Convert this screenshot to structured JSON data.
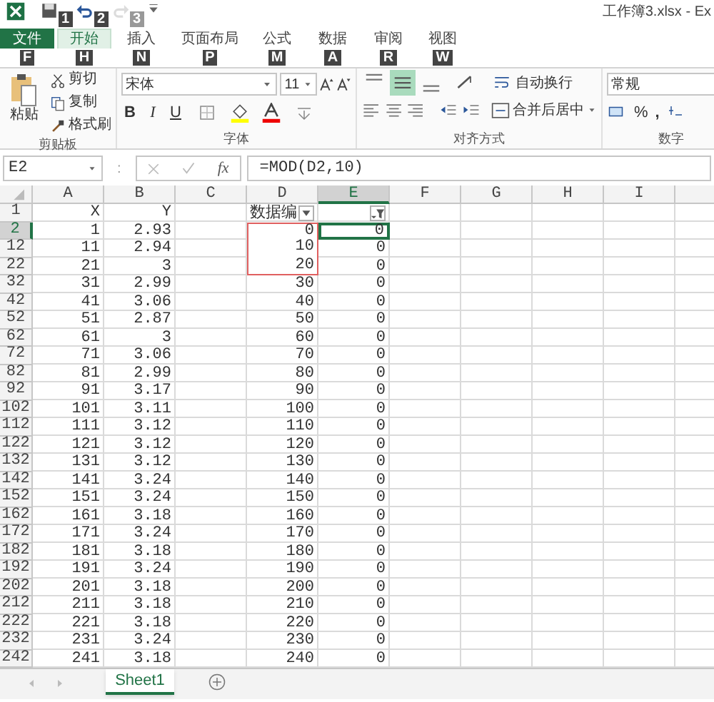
{
  "window": {
    "title": "工作簿3.xlsx - Ex"
  },
  "quick_access": [
    {
      "kind": "save",
      "keytip": "1",
      "disabled": false
    },
    {
      "kind": "undo",
      "keytip": "2",
      "disabled": false
    },
    {
      "kind": "redo",
      "keytip": "3",
      "disabled": true
    }
  ],
  "tabs": [
    {
      "label": "文件",
      "keytip": "F",
      "kind": "file",
      "selected": false
    },
    {
      "label": "开始",
      "keytip": "H",
      "kind": "tab",
      "selected": true
    },
    {
      "label": "插入",
      "keytip": "N",
      "kind": "tab",
      "selected": false
    },
    {
      "label": "页面布局",
      "keytip": "P",
      "kind": "tab",
      "selected": false
    },
    {
      "label": "公式",
      "keytip": "M",
      "kind": "tab",
      "selected": false
    },
    {
      "label": "数据",
      "keytip": "A",
      "kind": "tab",
      "selected": false
    },
    {
      "label": "审阅",
      "keytip": "R",
      "kind": "tab",
      "selected": false
    },
    {
      "label": "视图",
      "keytip": "W",
      "kind": "tab",
      "selected": false
    }
  ],
  "ribbon": {
    "clipboard": {
      "label": "剪贴板",
      "paste": "粘贴",
      "cut": "剪切",
      "copy": "复制",
      "format_painter": "格式刷"
    },
    "font": {
      "label": "字体",
      "font_name": "宋体",
      "font_size": "11",
      "bold": "B",
      "italic": "I",
      "underline": "U"
    },
    "alignment": {
      "label": "对齐方式",
      "vertical": [
        {
          "kind": "top",
          "selected": false
        },
        {
          "kind": "middle",
          "selected": true
        },
        {
          "kind": "bottom",
          "selected": false
        }
      ],
      "wrap_text": "自动换行",
      "merge_center": "合并后居中"
    },
    "number": {
      "label": "数字",
      "format": "常规",
      "percent": "%",
      "comma": ","
    }
  },
  "formula_bar": {
    "name_box": "E2",
    "separator": ":",
    "function_label": "fx",
    "formula": "=MOD(D2,10)"
  },
  "columns": [
    {
      "label": "A",
      "selected": false
    },
    {
      "label": "B",
      "selected": false
    },
    {
      "label": "C",
      "selected": false
    },
    {
      "label": "D",
      "selected": false
    },
    {
      "label": "E",
      "selected": true
    },
    {
      "label": "F",
      "selected": false
    },
    {
      "label": "G",
      "selected": false
    },
    {
      "label": "H",
      "selected": false
    },
    {
      "label": "I",
      "selected": false
    }
  ],
  "header_row": {
    "number": "1",
    "a": "X",
    "b": "Y",
    "d": "数据编",
    "d_filter": {
      "active": false
    },
    "e_filter": {
      "active": true
    }
  },
  "rows": [
    {
      "number": "2",
      "a": "1",
      "b": "2.93",
      "d": "0",
      "e": "0",
      "selected": true,
      "marked": true
    },
    {
      "number": "12",
      "a": "11",
      "b": "2.94",
      "d": "10",
      "e": "0",
      "selected": false,
      "marked": true
    },
    {
      "number": "22",
      "a": "21",
      "b": "3",
      "d": "20",
      "e": "0",
      "selected": false,
      "marked": true
    },
    {
      "number": "32",
      "a": "31",
      "b": "2.99",
      "d": "30",
      "e": "0",
      "selected": false,
      "marked": false
    },
    {
      "number": "42",
      "a": "41",
      "b": "3.06",
      "d": "40",
      "e": "0",
      "selected": false,
      "marked": false
    },
    {
      "number": "52",
      "a": "51",
      "b": "2.87",
      "d": "50",
      "e": "0",
      "selected": false,
      "marked": false
    },
    {
      "number": "62",
      "a": "61",
      "b": "3",
      "d": "60",
      "e": "0",
      "selected": false,
      "marked": false
    },
    {
      "number": "72",
      "a": "71",
      "b": "3.06",
      "d": "70",
      "e": "0",
      "selected": false,
      "marked": false
    },
    {
      "number": "82",
      "a": "81",
      "b": "2.99",
      "d": "80",
      "e": "0",
      "selected": false,
      "marked": false
    },
    {
      "number": "92",
      "a": "91",
      "b": "3.17",
      "d": "90",
      "e": "0",
      "selected": false,
      "marked": false
    },
    {
      "number": "102",
      "a": "101",
      "b": "3.11",
      "d": "100",
      "e": "0",
      "selected": false,
      "marked": false
    },
    {
      "number": "112",
      "a": "111",
      "b": "3.12",
      "d": "110",
      "e": "0",
      "selected": false,
      "marked": false
    },
    {
      "number": "122",
      "a": "121",
      "b": "3.12",
      "d": "120",
      "e": "0",
      "selected": false,
      "marked": false
    },
    {
      "number": "132",
      "a": "131",
      "b": "3.12",
      "d": "130",
      "e": "0",
      "selected": false,
      "marked": false
    },
    {
      "number": "142",
      "a": "141",
      "b": "3.24",
      "d": "140",
      "e": "0",
      "selected": false,
      "marked": false
    },
    {
      "number": "152",
      "a": "151",
      "b": "3.24",
      "d": "150",
      "e": "0",
      "selected": false,
      "marked": false
    },
    {
      "number": "162",
      "a": "161",
      "b": "3.18",
      "d": "160",
      "e": "0",
      "selected": false,
      "marked": false
    },
    {
      "number": "172",
      "a": "171",
      "b": "3.24",
      "d": "170",
      "e": "0",
      "selected": false,
      "marked": false
    },
    {
      "number": "182",
      "a": "181",
      "b": "3.18",
      "d": "180",
      "e": "0",
      "selected": false,
      "marked": false
    },
    {
      "number": "192",
      "a": "191",
      "b": "3.24",
      "d": "190",
      "e": "0",
      "selected": false,
      "marked": false
    },
    {
      "number": "202",
      "a": "201",
      "b": "3.18",
      "d": "200",
      "e": "0",
      "selected": false,
      "marked": false
    },
    {
      "number": "212",
      "a": "211",
      "b": "3.18",
      "d": "210",
      "e": "0",
      "selected": false,
      "marked": false
    },
    {
      "number": "222",
      "a": "221",
      "b": "3.18",
      "d": "220",
      "e": "0",
      "selected": false,
      "marked": false
    },
    {
      "number": "232",
      "a": "231",
      "b": "3.24",
      "d": "230",
      "e": "0",
      "selected": false,
      "marked": false
    },
    {
      "number": "242",
      "a": "241",
      "b": "3.18",
      "d": "240",
      "e": "0",
      "selected": false,
      "marked": false
    }
  ],
  "sheets": [
    {
      "label": "Sheet1",
      "selected": true
    }
  ]
}
